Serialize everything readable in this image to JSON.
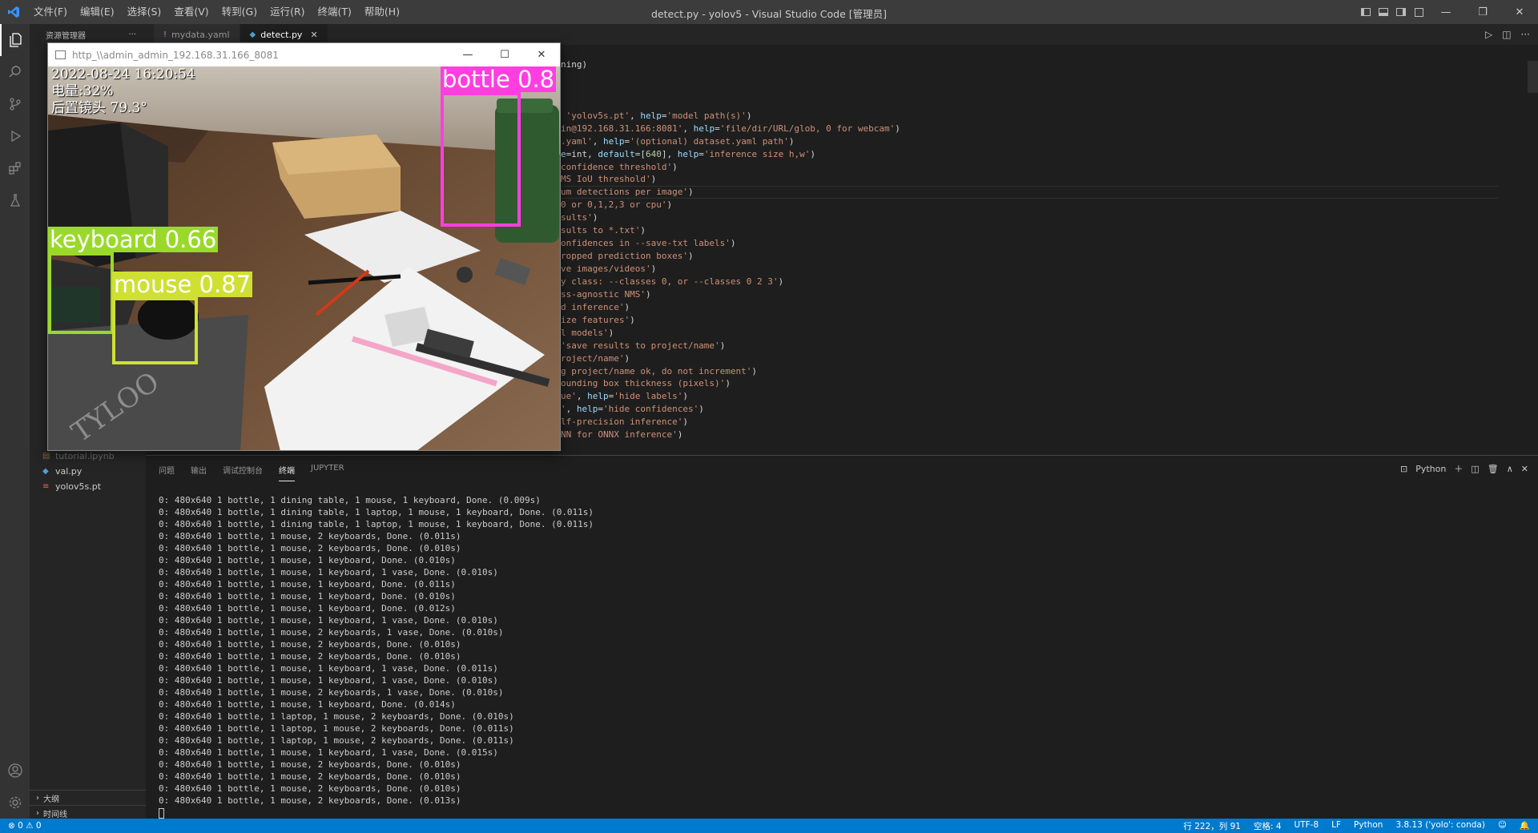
{
  "app": {
    "window_title": "detect.py - yolov5 - Visual Studio Code [管理员]",
    "menu": [
      "文件(F)",
      "编辑(E)",
      "选择(S)",
      "查看(V)",
      "转到(G)",
      "运行(R)",
      "终端(T)",
      "帮助(H)"
    ]
  },
  "sidebar": {
    "title": "资源管理器",
    "more": "···",
    "files": [
      {
        "name": "tutorial.ipynb",
        "icon": "notebook-icon"
      },
      {
        "name": "val.py",
        "icon": "python-icon"
      },
      {
        "name": "yolov5s.pt",
        "icon": "file-icon"
      }
    ],
    "sections": [
      "大纲",
      "时间线"
    ]
  },
  "tabs": [
    {
      "label": "mydata.yaml",
      "icon": "!"
    },
    {
      "label": "detect.py",
      "icon": "◆"
    }
  ],
  "code_lines": [
    [
      {
        "t": "ning)",
        "c": "p"
      }
    ],
    [],
    [],
    [],
    [
      {
        "t": " 'yolov5s.pt'",
        "c": "s"
      },
      {
        "t": ", ",
        "c": "p"
      },
      {
        "t": "help",
        "c": "k"
      },
      {
        "t": "=",
        "c": "p"
      },
      {
        "t": "'model path(s)'",
        "c": "s"
      },
      {
        "t": ")",
        "c": "p"
      }
    ],
    [
      {
        "t": "in@192.168.31.166:8081'",
        "c": "s"
      },
      {
        "t": ", ",
        "c": "p"
      },
      {
        "t": "help",
        "c": "k"
      },
      {
        "t": "=",
        "c": "p"
      },
      {
        "t": "'file/dir/URL/glob, 0 for webcam'",
        "c": "s"
      },
      {
        "t": ")",
        "c": "p"
      }
    ],
    [
      {
        "t": ".yaml'",
        "c": "s"
      },
      {
        "t": ", ",
        "c": "p"
      },
      {
        "t": "help",
        "c": "k"
      },
      {
        "t": "=",
        "c": "p"
      },
      {
        "t": "'(optional) dataset.yaml path'",
        "c": "s"
      },
      {
        "t": ")",
        "c": "p"
      }
    ],
    [
      {
        "t": "e",
        "c": "k"
      },
      {
        "t": "=int, ",
        "c": "p"
      },
      {
        "t": "default",
        "c": "k"
      },
      {
        "t": "=[",
        "c": "p"
      },
      {
        "t": "640",
        "c": "n"
      },
      {
        "t": "], ",
        "c": "p"
      },
      {
        "t": "help",
        "c": "k"
      },
      {
        "t": "=",
        "c": "p"
      },
      {
        "t": "'inference size h,w'",
        "c": "s"
      },
      {
        "t": ")",
        "c": "p"
      }
    ],
    [
      {
        "t": "confidence threshold'",
        "c": "s"
      },
      {
        "t": ")",
        "c": "p"
      }
    ],
    [
      {
        "t": "MS IoU threshold'",
        "c": "s"
      },
      {
        "t": ")",
        "c": "p"
      }
    ],
    [
      {
        "t": "um detections per image'",
        "c": "s"
      },
      {
        "t": ")",
        "c": "p"
      }
    ],
    [
      {
        "t": "0 or 0,1,2,3 or cpu'",
        "c": "s"
      },
      {
        "t": ")",
        "c": "p"
      }
    ],
    [
      {
        "t": "sults'",
        "c": "s"
      },
      {
        "t": ")",
        "c": "p"
      }
    ],
    [
      {
        "t": "sults to *.txt'",
        "c": "s"
      },
      {
        "t": ")",
        "c": "p"
      }
    ],
    [
      {
        "t": "onfidences in --save-txt labels'",
        "c": "s"
      },
      {
        "t": ")",
        "c": "p"
      }
    ],
    [
      {
        "t": "ropped prediction boxes'",
        "c": "s"
      },
      {
        "t": ")",
        "c": "p"
      }
    ],
    [
      {
        "t": "ve images/videos'",
        "c": "s"
      },
      {
        "t": ")",
        "c": "p"
      }
    ],
    [
      {
        "t": "y class: --classes 0, or --classes 0 2 3'",
        "c": "s"
      },
      {
        "t": ")",
        "c": "p"
      }
    ],
    [
      {
        "t": "ss-agnostic NMS'",
        "c": "s"
      },
      {
        "t": ")",
        "c": "p"
      }
    ],
    [
      {
        "t": "d inference'",
        "c": "s"
      },
      {
        "t": ")",
        "c": "p"
      }
    ],
    [
      {
        "t": "ize features'",
        "c": "s"
      },
      {
        "t": ")",
        "c": "p"
      }
    ],
    [
      {
        "t": "l models'",
        "c": "s"
      },
      {
        "t": ")",
        "c": "p"
      }
    ],
    [
      {
        "t": "'save results to project/name'",
        "c": "s"
      },
      {
        "t": ")",
        "c": "p"
      }
    ],
    [
      {
        "t": "roject/name'",
        "c": "s"
      },
      {
        "t": ")",
        "c": "p"
      }
    ],
    [
      {
        "t": "g project/name ok, do not increment'",
        "c": "s"
      },
      {
        "t": ")",
        "c": "p"
      }
    ],
    [
      {
        "t": "ounding box thickness (pixels)'",
        "c": "s"
      },
      {
        "t": ")",
        "c": "p"
      }
    ],
    [
      {
        "t": "ue'",
        "c": "s"
      },
      {
        "t": ", ",
        "c": "p"
      },
      {
        "t": "help",
        "c": "k"
      },
      {
        "t": "=",
        "c": "p"
      },
      {
        "t": "'hide labels'",
        "c": "s"
      },
      {
        "t": ")",
        "c": "p"
      }
    ],
    [
      {
        "t": "'",
        "c": "s"
      },
      {
        "t": ", ",
        "c": "p"
      },
      {
        "t": "help",
        "c": "k"
      },
      {
        "t": "=",
        "c": "p"
      },
      {
        "t": "'hide confidences'",
        "c": "s"
      },
      {
        "t": ")",
        "c": "p"
      }
    ],
    [
      {
        "t": "lf-precision inference'",
        "c": "s"
      },
      {
        "t": ")",
        "c": "p"
      }
    ],
    [
      {
        "t": "NN for ONNX inference'",
        "c": "s"
      },
      {
        "t": ")",
        "c": "p"
      }
    ]
  ],
  "panel": {
    "tabs": [
      "问题",
      "输出",
      "调试控制台",
      "终端",
      "JUPYTER"
    ],
    "active_tab": "终端",
    "shell": "Python",
    "terminal_lines": [
      "0: 480x640 1 bottle, 1 dining table, 1 mouse, 1 keyboard, Done. (0.009s)",
      "0: 480x640 1 bottle, 1 dining table, 1 laptop, 1 mouse, 1 keyboard, Done. (0.011s)",
      "0: 480x640 1 bottle, 1 dining table, 1 laptop, 1 mouse, 1 keyboard, Done. (0.011s)",
      "0: 480x640 1 bottle, 1 mouse, 2 keyboards, Done. (0.011s)",
      "0: 480x640 1 bottle, 1 mouse, 2 keyboards, Done. (0.010s)",
      "0: 480x640 1 bottle, 1 mouse, 1 keyboard, Done. (0.010s)",
      "0: 480x640 1 bottle, 1 mouse, 1 keyboard, 1 vase, Done. (0.010s)",
      "0: 480x640 1 bottle, 1 mouse, 1 keyboard, Done. (0.011s)",
      "0: 480x640 1 bottle, 1 mouse, 1 keyboard, Done. (0.010s)",
      "0: 480x640 1 bottle, 1 mouse, 1 keyboard, Done. (0.012s)",
      "0: 480x640 1 bottle, 1 mouse, 1 keyboard, 1 vase, Done. (0.010s)",
      "0: 480x640 1 bottle, 1 mouse, 2 keyboards, 1 vase, Done. (0.010s)",
      "0: 480x640 1 bottle, 1 mouse, 2 keyboards, Done. (0.010s)",
      "0: 480x640 1 bottle, 1 mouse, 2 keyboards, Done. (0.010s)",
      "0: 480x640 1 bottle, 1 mouse, 1 keyboard, 1 vase, Done. (0.011s)",
      "0: 480x640 1 bottle, 1 mouse, 1 keyboard, 1 vase, Done. (0.010s)",
      "0: 480x640 1 bottle, 1 mouse, 2 keyboards, 1 vase, Done. (0.010s)",
      "0: 480x640 1 bottle, 1 mouse, 1 keyboard, Done. (0.014s)",
      "0: 480x640 1 bottle, 1 laptop, 1 mouse, 2 keyboards, Done. (0.010s)",
      "0: 480x640 1 bottle, 1 laptop, 1 mouse, 2 keyboards, Done. (0.011s)",
      "0: 480x640 1 bottle, 1 laptop, 1 mouse, 2 keyboards, Done. (0.011s)",
      "0: 480x640 1 bottle, 1 mouse, 1 keyboard, 1 vase, Done. (0.015s)",
      "0: 480x640 1 bottle, 1 mouse, 2 keyboards, Done. (0.010s)",
      "0: 480x640 1 bottle, 1 mouse, 2 keyboards, Done. (0.010s)",
      "0: 480x640 1 bottle, 1 mouse, 2 keyboards, Done. (0.010s)",
      "0: 480x640 1 bottle, 1 mouse, 2 keyboards, Done. (0.013s)"
    ]
  },
  "status": {
    "problems": "⊗ 0 ⚠ 0",
    "position": "行 222，列 91",
    "spaces": "空格: 4",
    "encoding": "UTF-8",
    "eol": "LF",
    "language": "Python",
    "interpreter": "3.8.13 ('yolo': conda)"
  },
  "video_window": {
    "title": "http_\\\\admin_admin_192.168.31.166_8081",
    "osd_datetime": "2022-08-24 16:20:54",
    "osd_battery": "电量:32%",
    "osd_camera": "后置镜头 79.3°",
    "detections": [
      {
        "label": "bottle 0.8",
        "color": "#ff3ee0"
      },
      {
        "label": "keyboard 0.66",
        "color": "#9ad92a"
      },
      {
        "label": "mouse 0.87",
        "color": "#cfe033"
      }
    ]
  },
  "colors": {
    "accent": "#007acc",
    "activity_bar": "#333333",
    "sidebar": "#252526",
    "editor": "#1e1e1e"
  }
}
